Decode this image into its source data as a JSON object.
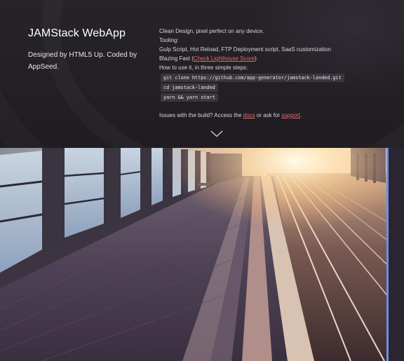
{
  "brand": {
    "title": "JAMStack WebApp",
    "subtitle": "Designed by HTML5 Up. Coded by AppSeed."
  },
  "info": {
    "line1": "Clean Design, pixel perfect on any device.",
    "line2": "Tooling:",
    "line3": "Gulp Script, Hot Reload, FTP Deployment script, SaaS customization",
    "line4_prefix": "Blazing Fast (",
    "line4_link": "Check Lighthouse Score",
    "line4_suffix": ")",
    "line5": "How to use it, in three simple steps:",
    "commands": [
      "git clone https://github.com/app-generator/jamstack-landed.git",
      "cd jamstack-landed",
      "yarn && yarn start"
    ],
    "issues_prefix": "Issues with the build? Access the ",
    "issues_docs": "docs",
    "issues_middle": " or ask for ",
    "issues_support": "support",
    "issues_suffix": "."
  },
  "icons": {
    "scroll": "chevron-down-icon"
  },
  "colors": {
    "link": "#e96a6a",
    "accent_bar": "#6b8fe8",
    "banner_bg": "#231f26"
  }
}
